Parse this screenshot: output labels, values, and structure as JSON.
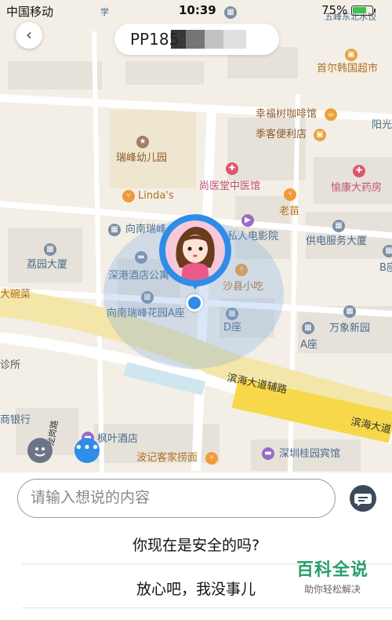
{
  "status_bar": {
    "carrier": "中国移动",
    "time": "10:39",
    "battery_percent": "75%",
    "battery_level": 0.75
  },
  "header": {
    "title_visible": "PP185",
    "back_icon": "chevron-left-icon"
  },
  "map": {
    "pois": [
      {
        "id": "poi-shouer",
        "label": "首尔韩国超市"
      },
      {
        "id": "poi-coffee",
        "label": "幸福树咖啡馆"
      },
      {
        "id": "poi-jike",
        "label": "季客便利店"
      },
      {
        "id": "poi-yang",
        "label": "阳光"
      },
      {
        "id": "poi-ruifeng-kg",
        "label": "瑞峰幼儿园"
      },
      {
        "id": "poi-shangyi",
        "label": "尚医堂中医馆"
      },
      {
        "id": "poi-yude",
        "label": "愉康大药房"
      },
      {
        "id": "poi-lindas",
        "label": "Linda's"
      },
      {
        "id": "poi-laoshan",
        "label": "老苗"
      },
      {
        "id": "poi-xiangnan1",
        "label": "向南瑞峰"
      },
      {
        "id": "poi-cinema",
        "label": "私人电影院"
      },
      {
        "id": "poi-gongdian",
        "label": "供电服务大厦"
      },
      {
        "id": "poi-liyuan",
        "label": "荔园大厦"
      },
      {
        "id": "poi-shengang",
        "label": "深港酒店公寓"
      },
      {
        "id": "poi-shaxian",
        "label": "沙县小吃"
      },
      {
        "id": "poi-bowl",
        "label": "大碗菜"
      },
      {
        "id": "poi-xiangnan2",
        "label": "向南瑞峰花园A座"
      },
      {
        "id": "poi-dzuo",
        "label": "D座"
      },
      {
        "id": "poi-wanxiang",
        "label": "万象新园"
      },
      {
        "id": "poi-azuo",
        "label": "A座"
      },
      {
        "id": "poi-zhensuo",
        "label": "诊所"
      },
      {
        "id": "poi-bank",
        "label": "商银行"
      },
      {
        "id": "poi-fengye",
        "label": "枫叶酒店"
      },
      {
        "id": "poi-haidilao",
        "label": "波记客家捞面"
      },
      {
        "id": "poi-guiyuan",
        "label": "深圳桂园宾馆"
      },
      {
        "id": "poi-wufeng",
        "label": "五峰东北水饺"
      },
      {
        "id": "poi-bzuo",
        "label": "B座"
      },
      {
        "id": "poi-xue",
        "label": "学"
      },
      {
        "id": "poi-road-fufu",
        "label": "滨海大道辅路"
      },
      {
        "id": "poi-road-binhai",
        "label": "滨海大道"
      },
      {
        "id": "poi-road-long",
        "label": "龙岗路"
      }
    ]
  },
  "panel": {
    "input_placeholder": "请输入想说的内容",
    "quick_replies": [
      "你现在是安全的吗?",
      "放心吧，我没事儿"
    ]
  },
  "watermark": {
    "title": "百科全说",
    "subtitle": "助你轻松解决"
  },
  "colors": {
    "accent_blue": "#2f8ce8",
    "map_bg": "#f3efe6",
    "highway_yellow": "#f7d84a",
    "watermark_green": "#27a06a"
  }
}
